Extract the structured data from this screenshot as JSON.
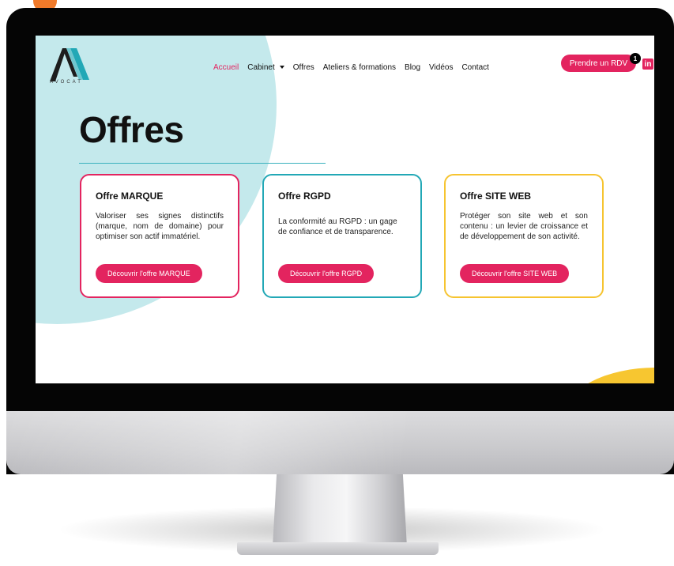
{
  "brand": {
    "logo_text": "AVOCAT",
    "accent_color": "#e3245f",
    "teal_color": "#22a8b6",
    "yellow_color": "#f6c430"
  },
  "nav": {
    "items": [
      {
        "label": "Accueil",
        "active": true
      },
      {
        "label": "Cabinet",
        "has_dropdown": true
      },
      {
        "label": "Offres"
      },
      {
        "label": "Ateliers & formations"
      },
      {
        "label": "Blog"
      },
      {
        "label": "Vidéos"
      },
      {
        "label": "Contact"
      }
    ],
    "cta_label": "Prendre un RDV",
    "badge_count": "1",
    "social_icon": "linkedin-icon",
    "social_label": "in"
  },
  "page": {
    "title": "Offres"
  },
  "cards": [
    {
      "title": "Offre MARQUE",
      "description": "Valoriser ses signes distinctifs (marque, nom de domaine) pour optimiser son actif immatériel.",
      "button_label": "Découvrir l'offre MARQUE",
      "border_color": "#e3245f"
    },
    {
      "title": "Offre RGPD",
      "description": "La conformité au RGPD : un gage de confiance et de transparence.",
      "button_label": "Découvrir l'offre RGPD",
      "border_color": "#22a8b6"
    },
    {
      "title": "Offre SITE WEB",
      "description": "Protéger son site web et son contenu : un levier de croissance et de développement de son activité.",
      "button_label": "Découvrir l'offre SITE WEB",
      "border_color": "#f6c430"
    }
  ]
}
